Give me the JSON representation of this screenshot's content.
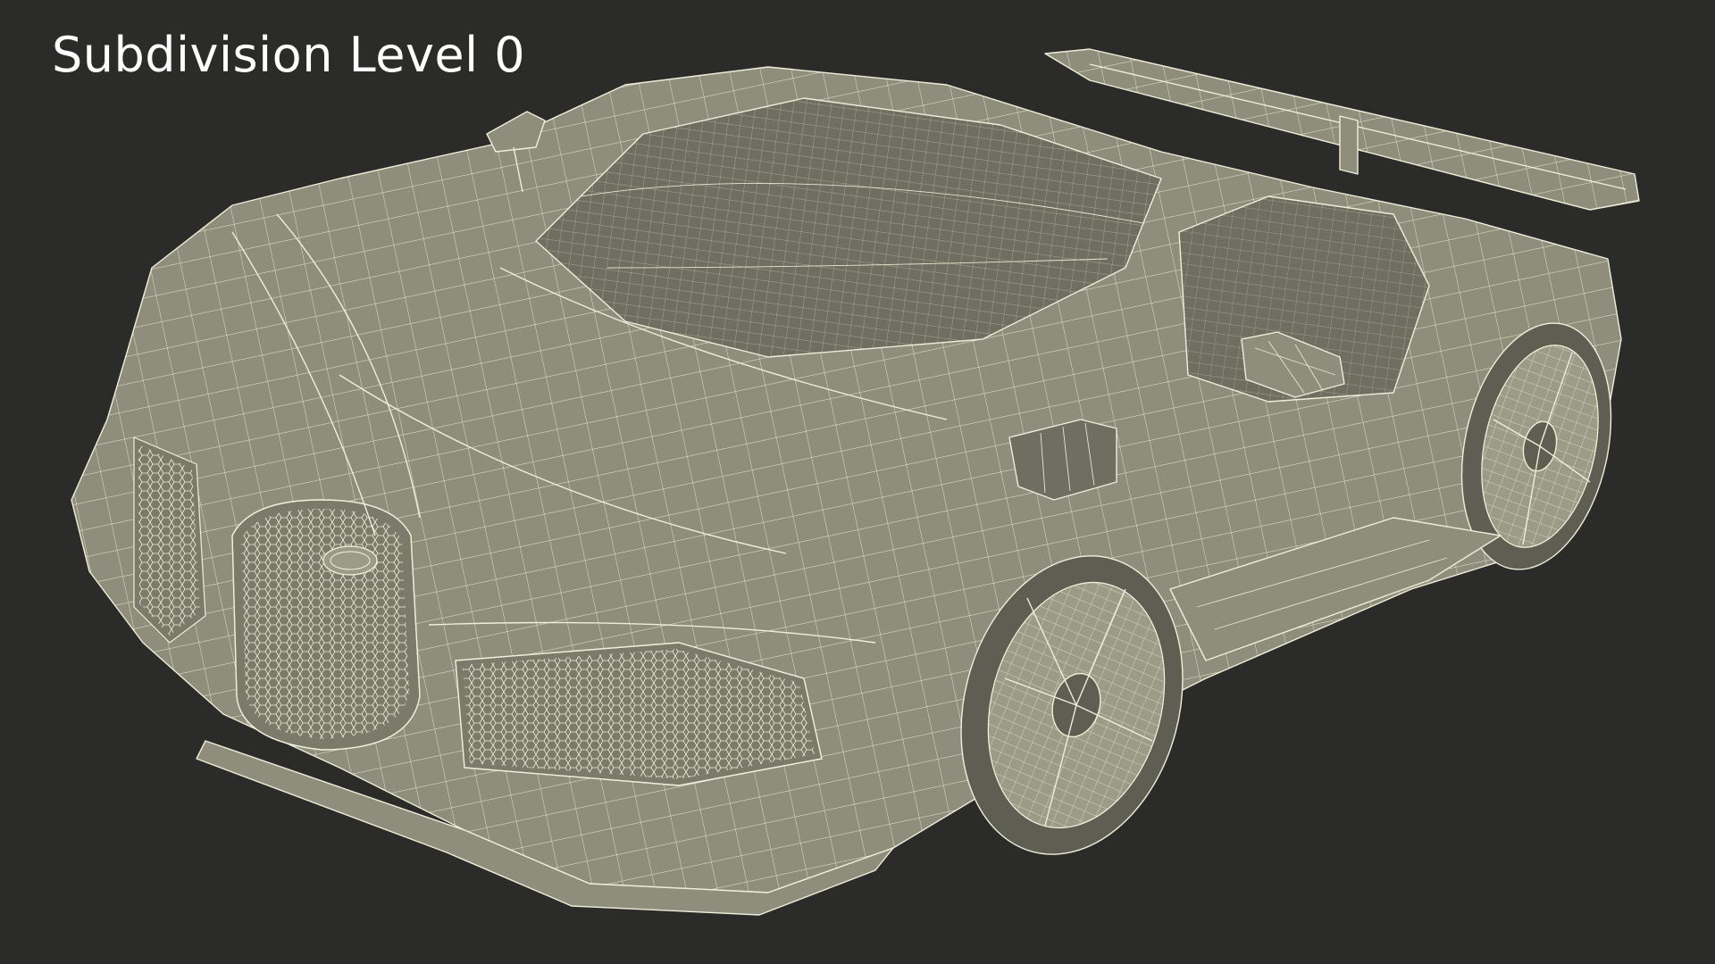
{
  "caption": {
    "text": "Subdivision Level 0"
  },
  "scene": {
    "subject": "wireframe-sports-car",
    "colors": {
      "background": "#2b2b29",
      "body": "#8f8e7c",
      "wire": "#eeeeda",
      "caption": "#ffffff"
    }
  }
}
